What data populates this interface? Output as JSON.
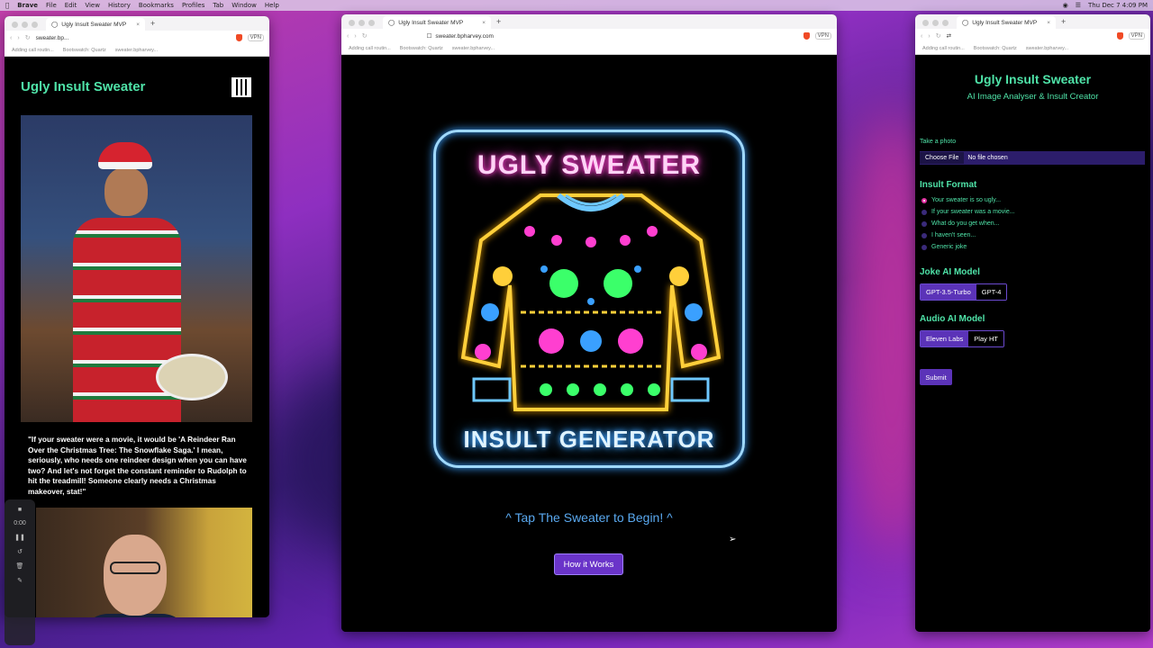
{
  "menubar": {
    "items": [
      "Brave",
      "File",
      "Edit",
      "View",
      "History",
      "Bookmarks",
      "Profiles",
      "Tab",
      "Window",
      "Help"
    ],
    "clock": "Thu Dec 7  4:09 PM"
  },
  "windows": {
    "left": {
      "tab_title": "Ugly Insult Sweater MVP",
      "url": "sweater.bp...",
      "bookmarks": [
        "Adding call routin...",
        "Bootswatch: Quartz",
        "sweater.bpharvey..."
      ],
      "page_title": "Ugly Insult Sweater",
      "quote": "\"If your sweater were a movie, it would be 'A Reindeer Ran Over the Christmas Tree: The Snowflake Saga.' I mean, seriously, who needs one reindeer design when you can have two? And let's not forget the constant reminder to Rudolph to hit the treadmill! Someone clearly needs a Christmas makeover, stat!\"",
      "recorder_time": "0:00"
    },
    "center": {
      "tab_title": "Ugly Insult Sweater MVP",
      "url": "sweater.bpharvey.com",
      "bookmarks": [
        "Adding call routin...",
        "Bootswatch: Quartz",
        "sweater.bpharvey..."
      ],
      "sign_top": "UGLY SWEATER",
      "sign_bottom": "INSULT GENERATOR",
      "tap_text": "^ Tap The Sweater to Begin! ^",
      "how_button": "How it Works"
    },
    "right": {
      "tab_title": "Ugly Insult Sweater MVP",
      "bookmarks": [
        "Adding call routin...",
        "Bootswatch: Quartz",
        "sweater.bpharvey..."
      ],
      "title": "Ugly Insult Sweater",
      "subtitle": "AI Image Analyser & Insult Creator",
      "photo_label": "Take a photo",
      "choose_file": "Choose File",
      "no_file": "No file chosen",
      "insult_format_heading": "Insult Format",
      "insult_options": [
        "Your sweater is so ugly...",
        "If your sweater was a movie...",
        "What do you get when...",
        "I haven't seen...",
        "Generic joke"
      ],
      "joke_model_heading": "Joke AI Model",
      "joke_models": [
        "GPT-3.5-Turbo",
        "GPT-4"
      ],
      "audio_model_heading": "Audio AI Model",
      "audio_models": [
        "Eleven Labs",
        "Play HT"
      ],
      "submit": "Submit"
    }
  },
  "colors": {
    "accent_green": "#4fe3a8",
    "button_purple": "#5b33b8",
    "neon_pink": "#ff3fd0",
    "neon_blue": "#3aa0ff"
  }
}
